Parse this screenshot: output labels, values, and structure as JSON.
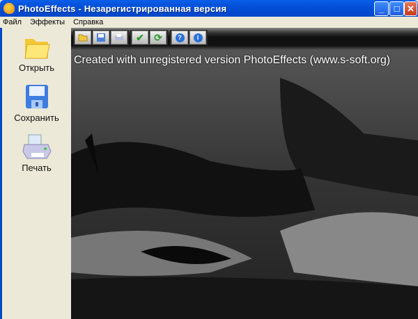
{
  "window": {
    "title": "PhotoEffects - Незарегистрированная версия",
    "minimize": "_",
    "maximize": "□",
    "close": "✕"
  },
  "menu": [
    "Файл",
    "Эффекты",
    "Справка"
  ],
  "sidebar": [
    {
      "label": "Открыть",
      "icon": "folder-icon"
    },
    {
      "label": "Сохранить",
      "icon": "floppy-icon"
    },
    {
      "label": "Печать",
      "icon": "printer-icon"
    }
  ],
  "toolbar": {
    "groups": [
      [
        "open",
        "save",
        "save-as"
      ],
      [
        "apply",
        "refresh"
      ],
      [
        "help",
        "info"
      ]
    ]
  },
  "canvas": {
    "watermark": "Created with unregistered version PhotoEffects (www.s-soft.org)"
  }
}
